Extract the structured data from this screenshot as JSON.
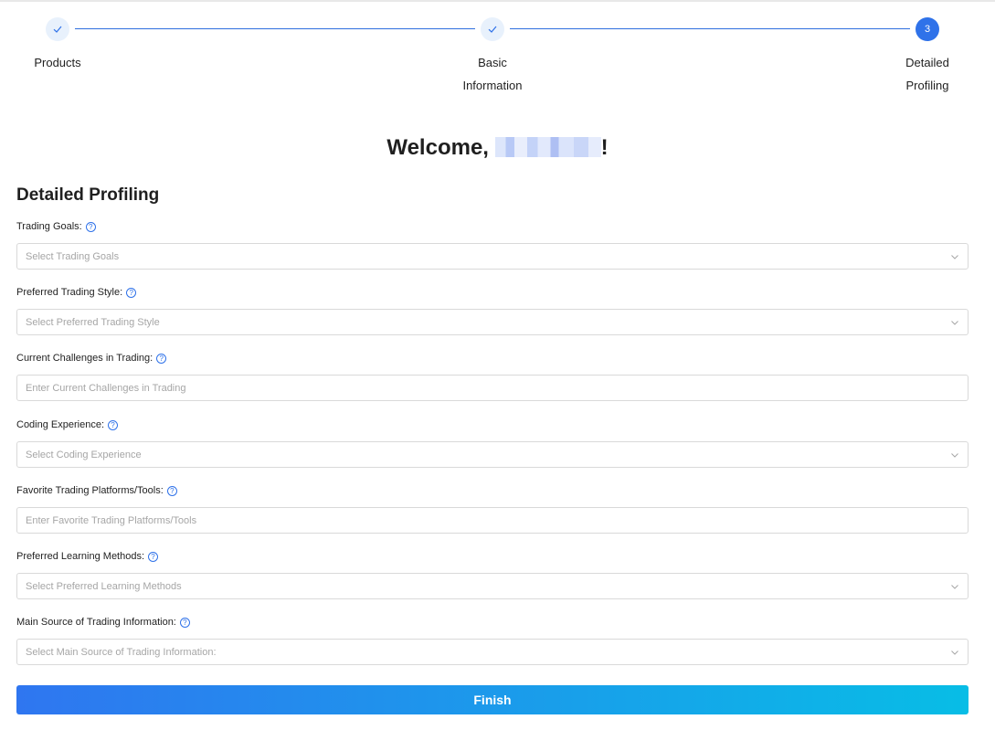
{
  "stepper": {
    "steps": [
      {
        "label_lines": [
          "Products"
        ],
        "status": "done"
      },
      {
        "label_lines": [
          "Basic",
          "Information"
        ],
        "status": "done"
      },
      {
        "label_lines": [
          "Detailed",
          "Profiling"
        ],
        "status": "active",
        "number": "3"
      }
    ],
    "accent_color": "#2f72e9"
  },
  "welcome": {
    "prefix": "Welcome, ",
    "name_redacted": true,
    "suffix": "!"
  },
  "section_title": "Detailed Profiling",
  "fields": [
    {
      "label": "Trading Goals:",
      "type": "select",
      "placeholder": "Select Trading Goals"
    },
    {
      "label": "Preferred Trading Style:",
      "type": "select",
      "placeholder": "Select Preferred Trading Style"
    },
    {
      "label": "Current Challenges in Trading:",
      "type": "input",
      "placeholder": "Enter Current Challenges in Trading"
    },
    {
      "label": "Coding Experience:",
      "type": "select",
      "placeholder": "Select Coding Experience"
    },
    {
      "label": "Favorite Trading Platforms/Tools:",
      "type": "input",
      "placeholder": "Enter Favorite Trading Platforms/Tools"
    },
    {
      "label": "Preferred Learning Methods:",
      "type": "select",
      "placeholder": "Select Preferred Learning Methods"
    },
    {
      "label": "Main Source of Trading Information:",
      "type": "select",
      "placeholder": "Select Main Source of Trading Information:"
    }
  ],
  "finish_label": "Finish",
  "icons": {
    "done_step": "check-icon",
    "help": "question-circle-icon",
    "select_arrow": "chevron-down-icon"
  }
}
